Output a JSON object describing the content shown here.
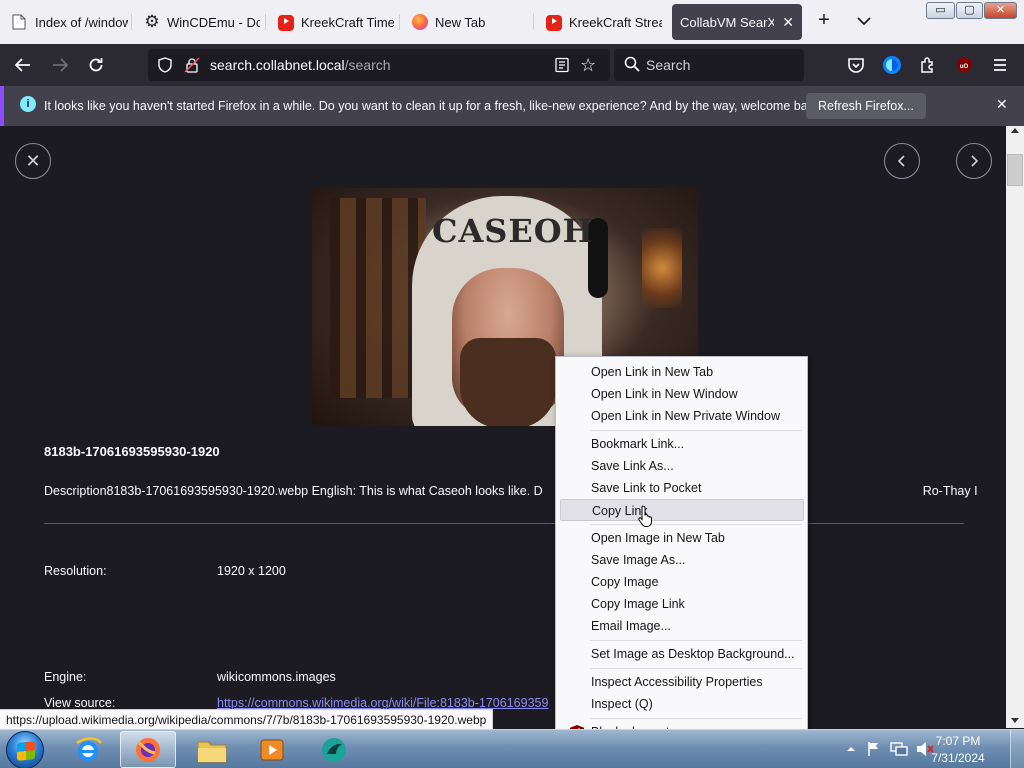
{
  "tabs": [
    {
      "label": "Index of /windows",
      "icon": "file-icon"
    },
    {
      "label": "WinCDEmu - Do",
      "icon": "gear-icon"
    },
    {
      "label": "KreekCraft Time",
      "icon": "youtube-icon"
    },
    {
      "label": "New Tab",
      "icon": "firefox-icon"
    },
    {
      "label": "KreekCraft Strea",
      "icon": "youtube-icon"
    },
    {
      "label": "CollabVM SearXN",
      "icon": "none",
      "active": true
    }
  ],
  "window_controls": {
    "minimize": "▭",
    "maximize": "▢",
    "close": "✕"
  },
  "navbar": {
    "url_host": "search.collabnet.local",
    "url_path": "/search",
    "search_placeholder": "Search"
  },
  "notification": {
    "message": "It looks like you haven't started Firefox in a while. Do you want to clean it up for a fresh, like-new experience? And by the way, welcome back!",
    "button": "Refresh Firefox..."
  },
  "page": {
    "photo_text": "CASEOH",
    "image_title": "8183b-17061693595930-1920",
    "description": "Description8183b-17061693595930-1920.webp English: This is what Caseoh looks like. D",
    "description_tail": "Ro-Thay I",
    "resolution_label": "Resolution:",
    "resolution_value": "1920 x 1200",
    "engine_label": "Engine:",
    "engine_value": "wikicommons.images",
    "source_label": "View source:",
    "source_value": "https://commons.wikimedia.org/wiki/File:8183b-1706169359",
    "status_url": "https://upload.wikimedia.org/wikipedia/commons/7/7b/8183b-17061693595930-1920.webp"
  },
  "context_menu": {
    "items": [
      "Open Link in New Tab",
      "Open Link in New Window",
      "Open Link in New Private Window",
      "Bookmark Link...",
      "Save Link As...",
      "Save Link to Pocket",
      "Copy Link",
      "Open Image in New Tab",
      "Save Image As...",
      "Copy Image",
      "Copy Image Link",
      "Email Image...",
      "Set Image as Desktop Background...",
      "Inspect Accessibility Properties",
      "Inspect (Q)",
      "Block element..."
    ],
    "highlighted": "Copy Link",
    "ublock_badge": "uO"
  },
  "taskbar": {
    "time": "7:07 PM",
    "date": "7/31/2024"
  },
  "colors": {
    "page_bg": "#1c1b22",
    "toolbar_bg": "#2b2a33",
    "notification_accent": "#8a4dff",
    "link": "#8c8cf5"
  }
}
